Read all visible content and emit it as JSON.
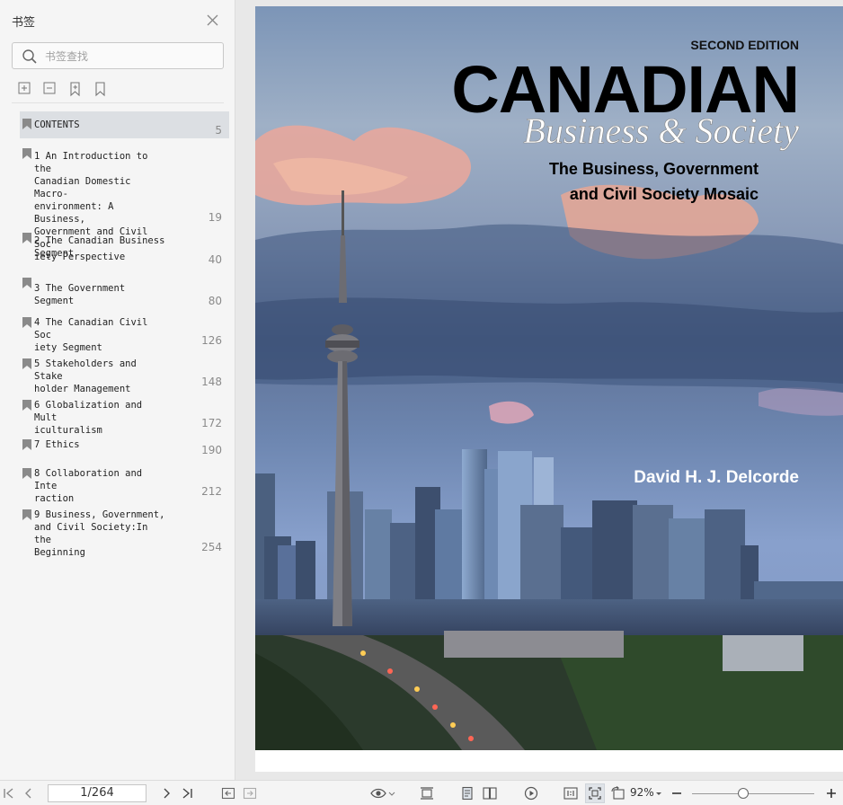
{
  "sidebar": {
    "title": "书签",
    "search_placeholder": "书签查找",
    "bookmarks": [
      {
        "label": "CONTENTS",
        "page": "5"
      },
      {
        "label": "1 An Introduction to the\nCanadian Domestic Macro-\nenvironment: A Business,\nGovernment and Civil Soc\niety Perspective",
        "page": "19"
      },
      {
        "label": "2 The Canadian Business\nSegment",
        "page": "40"
      },
      {
        "label": "3 The Government Segment",
        "page": "80"
      },
      {
        "label": "4 The Canadian Civil Soc\niety Segment",
        "page": "126"
      },
      {
        "label": "5 Stakeholders and Stake\nholder Management",
        "page": "148"
      },
      {
        "label": "6 Globalization and Mult\niculturalism",
        "page": "172"
      },
      {
        "label": "7 Ethics",
        "page": "190"
      },
      {
        "label": "8 Collaboration and Inte\nraction",
        "page": "212"
      },
      {
        "label": "9 Business, Government,\nand Civil Society:In the\nBeginning",
        "page": "254"
      }
    ]
  },
  "cover": {
    "edition": "SECOND EDITION",
    "title": "CANADIAN",
    "script_title": "Business & Society",
    "subtitle_line1": "The Business, Government",
    "subtitle_line2": "and Civil Society Mosaic",
    "author": "David H. J. Delcorde"
  },
  "bottombar": {
    "page_indicator": "1/264",
    "zoom": "92%",
    "zoom_level": 0.42
  },
  "colors": {
    "sidebar_bg": "#f5f5f5",
    "active_bookmark_bg": "#dcdfe3",
    "viewer_bg": "#e8e8e8"
  }
}
